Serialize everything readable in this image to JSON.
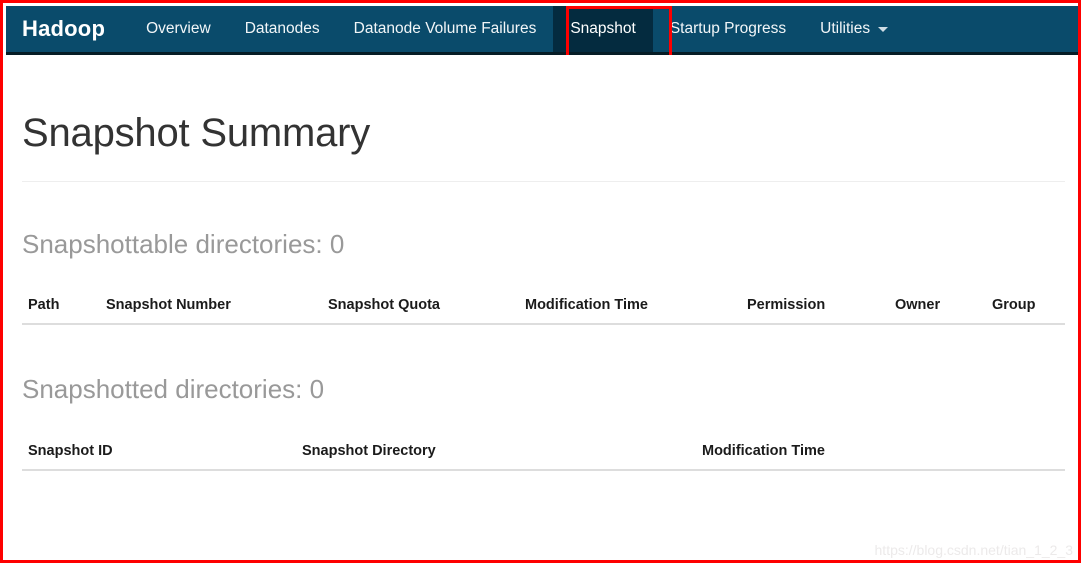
{
  "navbar": {
    "brand": "Hadoop",
    "items": [
      {
        "label": "Overview",
        "active": false,
        "caret": false
      },
      {
        "label": "Datanodes",
        "active": false,
        "caret": false
      },
      {
        "label": "Datanode Volume Failures",
        "active": false,
        "caret": false
      },
      {
        "label": "Snapshot",
        "active": true,
        "caret": false
      },
      {
        "label": "Startup Progress",
        "active": false,
        "caret": false
      },
      {
        "label": "Utilities",
        "active": false,
        "caret": true
      }
    ],
    "highlight_target": "Snapshot",
    "background_color": "#0a4b6b",
    "active_background_color": "#042b3f",
    "highlight_color": "#fe0000"
  },
  "page": {
    "title": "Snapshot Summary"
  },
  "sections": [
    {
      "heading": "Snapshottable directories: 0",
      "columns": [
        "Path",
        "Snapshot Number",
        "Snapshot Quota",
        "Modification Time",
        "Permission",
        "Owner",
        "Group"
      ],
      "rows": []
    },
    {
      "heading": "Snapshotted directories: 0",
      "columns": [
        "Snapshot ID",
        "Snapshot Directory",
        "Modification Time"
      ],
      "rows": []
    }
  ],
  "watermark": "https://blog.csdn.net/tian_1_2_3"
}
